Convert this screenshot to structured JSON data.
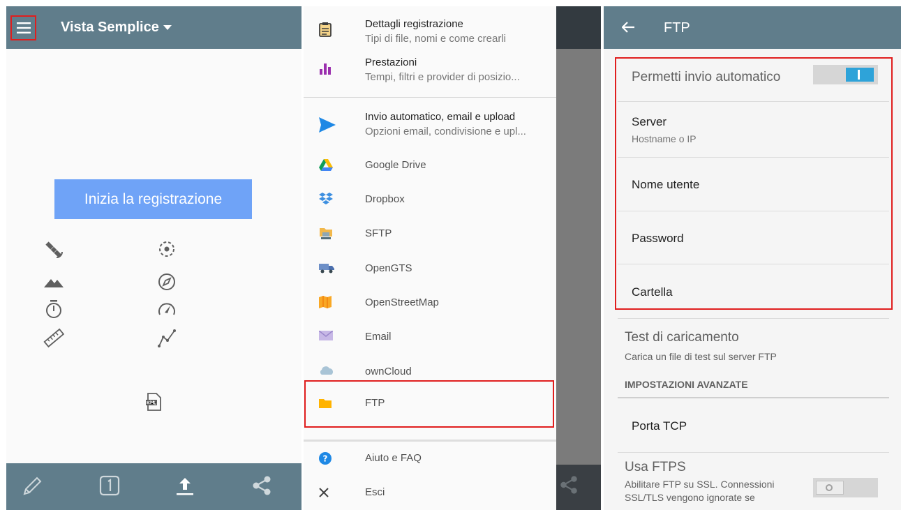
{
  "panel1": {
    "title": "Vista Semplice",
    "start_button": "Inizia la registrazione",
    "colors": {
      "appbar": "#607d8b",
      "start_button": "#6fa3f7",
      "highlight": "#e01e1e"
    },
    "status_icons": [
      "satellite-icon",
      "gps-fix-icon",
      "altitude-icon",
      "compass-icon",
      "timer-icon",
      "speed-icon",
      "distance-icon",
      "track-points-icon",
      "kml-file-icon"
    ],
    "bottom_icons": [
      "annotate-pencil-icon",
      "single-point-icon",
      "upload-icon",
      "share-icon"
    ]
  },
  "drawer": {
    "items": [
      {
        "title": "Dettagli registrazione",
        "subtitle": "Tipi di file, nomi e come crearli",
        "icon": "clipboard-icon"
      },
      {
        "title": "Prestazioni",
        "subtitle": "Tempi, filtri e provider di posizio...",
        "icon": "bar-chart-icon"
      },
      {
        "title": "Invio automatico, email e upload",
        "subtitle": "Opzioni email, condivisione e upl...",
        "icon": "send-icon"
      },
      {
        "title": "Google Drive",
        "icon": "google-drive-icon"
      },
      {
        "title": "Dropbox",
        "icon": "dropbox-icon"
      },
      {
        "title": "SFTP",
        "icon": "sftp-icon"
      },
      {
        "title": "OpenGTS",
        "icon": "truck-icon"
      },
      {
        "title": "OpenStreetMap",
        "icon": "map-icon"
      },
      {
        "title": "Email",
        "icon": "email-icon"
      },
      {
        "title": "ownCloud",
        "icon": "cloud-icon"
      },
      {
        "title": "FTP",
        "icon": "folder-icon"
      },
      {
        "title": "Aiuto e FAQ",
        "icon": "help-icon"
      },
      {
        "title": "Esci",
        "icon": "close-icon"
      }
    ]
  },
  "ftp": {
    "title": "FTP",
    "auto_send": {
      "label": "Permetti invio automatico",
      "enabled": true
    },
    "server": {
      "label": "Server",
      "summary": "Hostname o IP"
    },
    "username": {
      "label": "Nome utente"
    },
    "password": {
      "label": "Password"
    },
    "folder": {
      "label": "Cartella"
    },
    "test_upload": {
      "label": "Test di caricamento",
      "summary": "Carica un file di test sul server FTP"
    },
    "advanced_header": "IMPOSTAZIONI AVANZATE",
    "port": {
      "label": "Porta TCP"
    },
    "ftps": {
      "label": "Usa FTPS",
      "summary_line1": "Abilitare FTP su SSL. Connessioni",
      "summary_line2": "SSL/TLS vengono ignorate se",
      "enabled": false
    }
  }
}
